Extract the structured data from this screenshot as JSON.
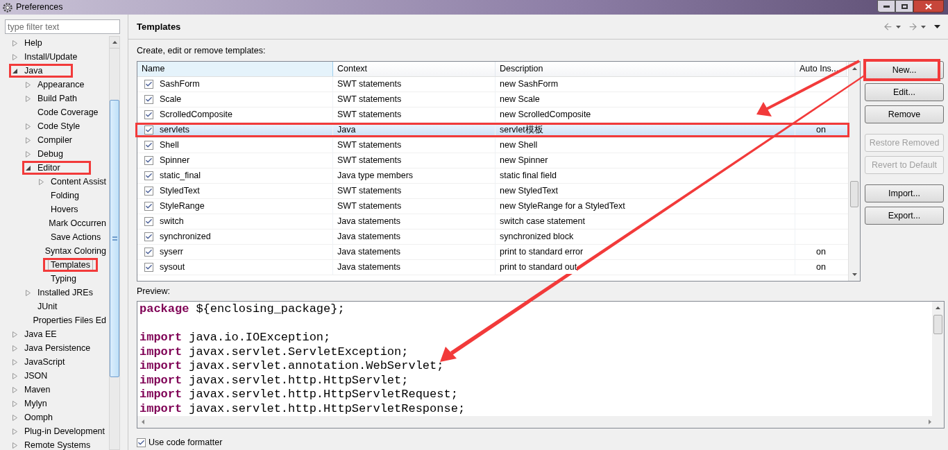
{
  "window": {
    "title": "Preferences"
  },
  "filter": {
    "placeholder": "type filter text"
  },
  "tree": [
    {
      "label": "Help",
      "expanded": false,
      "selected": false
    },
    {
      "label": "Install/Update",
      "expanded": false,
      "selected": false
    },
    {
      "label": "Java",
      "expanded": true,
      "selected": false,
      "annotated": true,
      "children": [
        {
          "label": "Appearance",
          "expanded": false,
          "selected": false
        },
        {
          "label": "Build Path",
          "expanded": false,
          "selected": false
        },
        {
          "label": "Code Coverage",
          "selected": false
        },
        {
          "label": "Code Style",
          "expanded": false,
          "selected": false
        },
        {
          "label": "Compiler",
          "expanded": false,
          "selected": false
        },
        {
          "label": "Debug",
          "expanded": false,
          "selected": false
        },
        {
          "label": "Editor",
          "expanded": true,
          "selected": false,
          "annotated": true,
          "children": [
            {
              "label": "Content Assist",
              "expanded": false,
              "selected": false
            },
            {
              "label": "Folding",
              "selected": false
            },
            {
              "label": "Hovers",
              "selected": false
            },
            {
              "label": "Mark Occurren",
              "selected": false
            },
            {
              "label": "Save Actions",
              "selected": false
            },
            {
              "label": "Syntax Coloring",
              "selected": false
            },
            {
              "label": "Templates",
              "selected": true,
              "annotated": true
            },
            {
              "label": "Typing",
              "selected": false
            }
          ]
        },
        {
          "label": "Installed JREs",
          "expanded": false,
          "selected": false
        },
        {
          "label": "JUnit",
          "selected": false
        },
        {
          "label": "Properties Files Ed",
          "selected": false
        }
      ]
    },
    {
      "label": "Java EE",
      "expanded": false,
      "selected": false
    },
    {
      "label": "Java Persistence",
      "expanded": false,
      "selected": false
    },
    {
      "label": "JavaScript",
      "expanded": false,
      "selected": false
    },
    {
      "label": "JSON",
      "expanded": false,
      "selected": false
    },
    {
      "label": "Maven",
      "expanded": false,
      "selected": false
    },
    {
      "label": "Mylyn",
      "expanded": false,
      "selected": false
    },
    {
      "label": "Oomph",
      "expanded": false,
      "selected": false
    },
    {
      "label": "Plug-in Development",
      "expanded": false,
      "selected": false
    },
    {
      "label": "Remote Systems",
      "expanded": false,
      "selected": false
    }
  ],
  "page": {
    "title": "Templates",
    "intro": "Create, edit or remove templates:"
  },
  "table": {
    "columns": [
      "Name",
      "Context",
      "Description",
      "Auto Ins..."
    ],
    "rows": [
      {
        "name": "SashForm",
        "context": "SWT statements",
        "description": "new SashForm",
        "checked": true,
        "selected": false
      },
      {
        "name": "Scale",
        "context": "SWT statements",
        "description": "new Scale",
        "checked": true,
        "selected": false
      },
      {
        "name": "ScrolledComposite",
        "context": "SWT statements",
        "description": "new ScrolledComposite",
        "checked": true,
        "selected": false
      },
      {
        "name": "servlets",
        "context": "Java",
        "description": "servlet模板",
        "auto_insert": "on",
        "checked": true,
        "selected": true,
        "annotated": true
      },
      {
        "name": "Shell",
        "context": "SWT statements",
        "description": "new Shell",
        "checked": true,
        "selected": false
      },
      {
        "name": "Spinner",
        "context": "SWT statements",
        "description": "new Spinner",
        "checked": true,
        "selected": false
      },
      {
        "name": "static_final",
        "context": "Java type members",
        "description": "static final field",
        "checked": true,
        "selected": false
      },
      {
        "name": "StyledText",
        "context": "SWT statements",
        "description": "new StyledText",
        "checked": true,
        "selected": false
      },
      {
        "name": "StyleRange",
        "context": "SWT statements",
        "description": "new StyleRange for a StyledText",
        "checked": true,
        "selected": false
      },
      {
        "name": "switch",
        "context": "Java statements",
        "description": "switch case statement",
        "checked": true,
        "selected": false
      },
      {
        "name": "synchronized",
        "context": "Java statements",
        "description": "synchronized block",
        "checked": true,
        "selected": false
      },
      {
        "name": "syserr",
        "context": "Java statements",
        "description": "print to standard error",
        "auto_insert": "on",
        "checked": true,
        "selected": false
      },
      {
        "name": "sysout",
        "context": "Java statements",
        "description": "print to standard out",
        "auto_insert": "on",
        "checked": true,
        "selected": false
      }
    ]
  },
  "buttons": [
    {
      "label": "New...",
      "disabled": false,
      "annotated": true
    },
    {
      "label": "Edit...",
      "disabled": false
    },
    {
      "label": "Remove",
      "disabled": false
    },
    {
      "label": "Restore Removed",
      "disabled": true
    },
    {
      "label": "Revert to Default",
      "disabled": true
    },
    {
      "label": "Import...",
      "disabled": false
    },
    {
      "label": "Export...",
      "disabled": false
    }
  ],
  "preview": {
    "label": "Preview:",
    "lines": [
      {
        "kind": "code",
        "keyword": "package",
        "text": "${enclosing_package};"
      },
      {
        "kind": "blank"
      },
      {
        "kind": "code",
        "keyword": "import",
        "text": "java.io.IOException;"
      },
      {
        "kind": "code",
        "keyword": "import",
        "text": "javax.servlet.ServletException;"
      },
      {
        "kind": "code",
        "keyword": "import",
        "text": "javax.servlet.annotation.WebServlet;"
      },
      {
        "kind": "code",
        "keyword": "import",
        "text": "javax.servlet.http.HttpServlet;"
      },
      {
        "kind": "code",
        "keyword": "import",
        "text": "javax.servlet.http.HttpServletRequest;"
      },
      {
        "kind": "code",
        "keyword": "import",
        "text": "javax.servlet.http.HttpServletResponse;"
      }
    ]
  },
  "formatter": {
    "label": "Use code formatter",
    "checked": true
  }
}
